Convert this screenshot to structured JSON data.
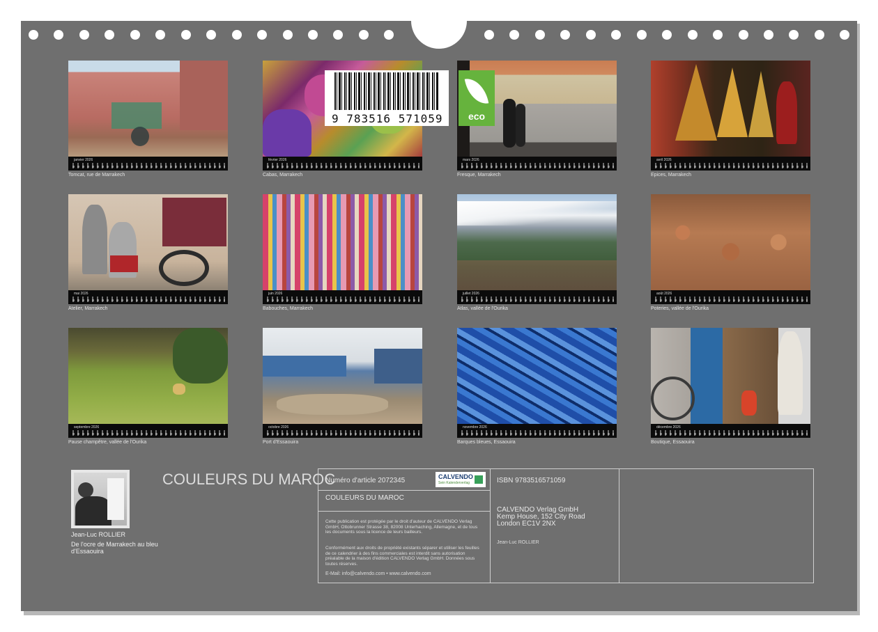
{
  "months": [
    {
      "label": "janvier 2026",
      "caption": "Tomcat, rue de Marrakech"
    },
    {
      "label": "février 2026",
      "caption": "Cabas, Marrakech"
    },
    {
      "label": "mars 2026",
      "caption": "Fresque, Marrakech"
    },
    {
      "label": "avril 2026",
      "caption": "Epices, Marrakech"
    },
    {
      "label": "mai 2026",
      "caption": "Atelier, Marrakech"
    },
    {
      "label": "juin 2026",
      "caption": "Babouches, Marrakech"
    },
    {
      "label": "juillet 2026",
      "caption": "Atlas, vallée de l'Ourika"
    },
    {
      "label": "août 2026",
      "caption": "Poteries, vallée de l'Ourika"
    },
    {
      "label": "septembre 2026",
      "caption": "Pause champêtre, vallée de l'Ourika"
    },
    {
      "label": "octobre 2026",
      "caption": "Port d'Essaouira"
    },
    {
      "label": "novembre 2026",
      "caption": "Barques bleues, Essaouira"
    },
    {
      "label": "décembre 2026",
      "caption": "Boutique, Essaouira"
    }
  ],
  "author": {
    "name": "Jean-Luc ROLLIER",
    "description": "De l'ocre de Marrakech au bleu d'Essaouira"
  },
  "title": "COULEURS DU MAROC",
  "info": {
    "article": "Numéro d'article 2072345",
    "title": "COULEURS DU MAROC",
    "copyright1": "Cette publication est protégée par le droit d'auteur de CALVENDO Verlag GmbH, Ottobrunner Strasse 38, 82008 Unterhaching, Allemagne, et de tous les documents sous la licence de leurs bailleurs.",
    "copyright2": "Conformément aux droits de propriété existants séparer et utiliser les feuilles de ce calendrier à des fins commerciales est interdit sans autorisation préalable de la maison d'édition CALVENDO Verlag GmbH. Données sous toutes réserves.",
    "email": "E-Mail: info@calvendo.com • www.calvendo.com",
    "isbn": "ISBN 9783516571059",
    "publisher1": "CALVENDO Verlag GmbH",
    "publisher2": "Kemp House, 152 City Road",
    "publisher3": "London EC1V 2NX",
    "author": "Jean-Luc ROLLIER",
    "logo_name": "CALVENDO",
    "logo_sub": "Sein Kalenderverlag",
    "barcode_number": "9 783516 571059",
    "eco_label": "eco"
  },
  "colors": {
    "board": "#6f6f6f",
    "eco": "#66b33d"
  }
}
